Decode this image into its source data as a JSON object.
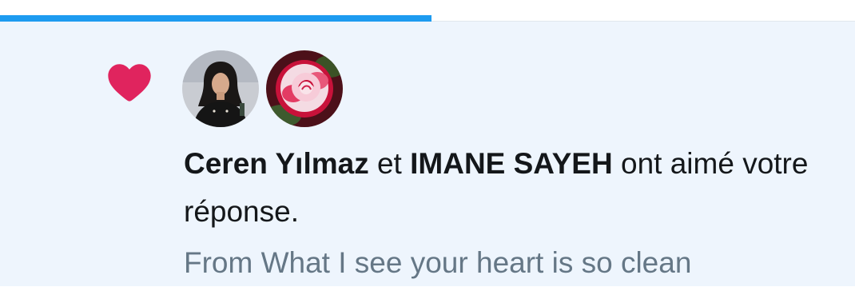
{
  "progress": {
    "fraction": 0.505,
    "color": "#1d9bf0"
  },
  "notification": {
    "icon": "heart-icon",
    "icon_color": "#e0245e",
    "background": "#eef5fd",
    "avatars": [
      {
        "name": "avatar-person-icon"
      },
      {
        "name": "avatar-rose-icon"
      }
    ],
    "user1": "Ceren Yılmaz",
    "connector": " et ",
    "user2": "IMANE SAYEH",
    "action": " ont aimé votre réponse.",
    "preview": "From What I see your heart is so clean"
  }
}
